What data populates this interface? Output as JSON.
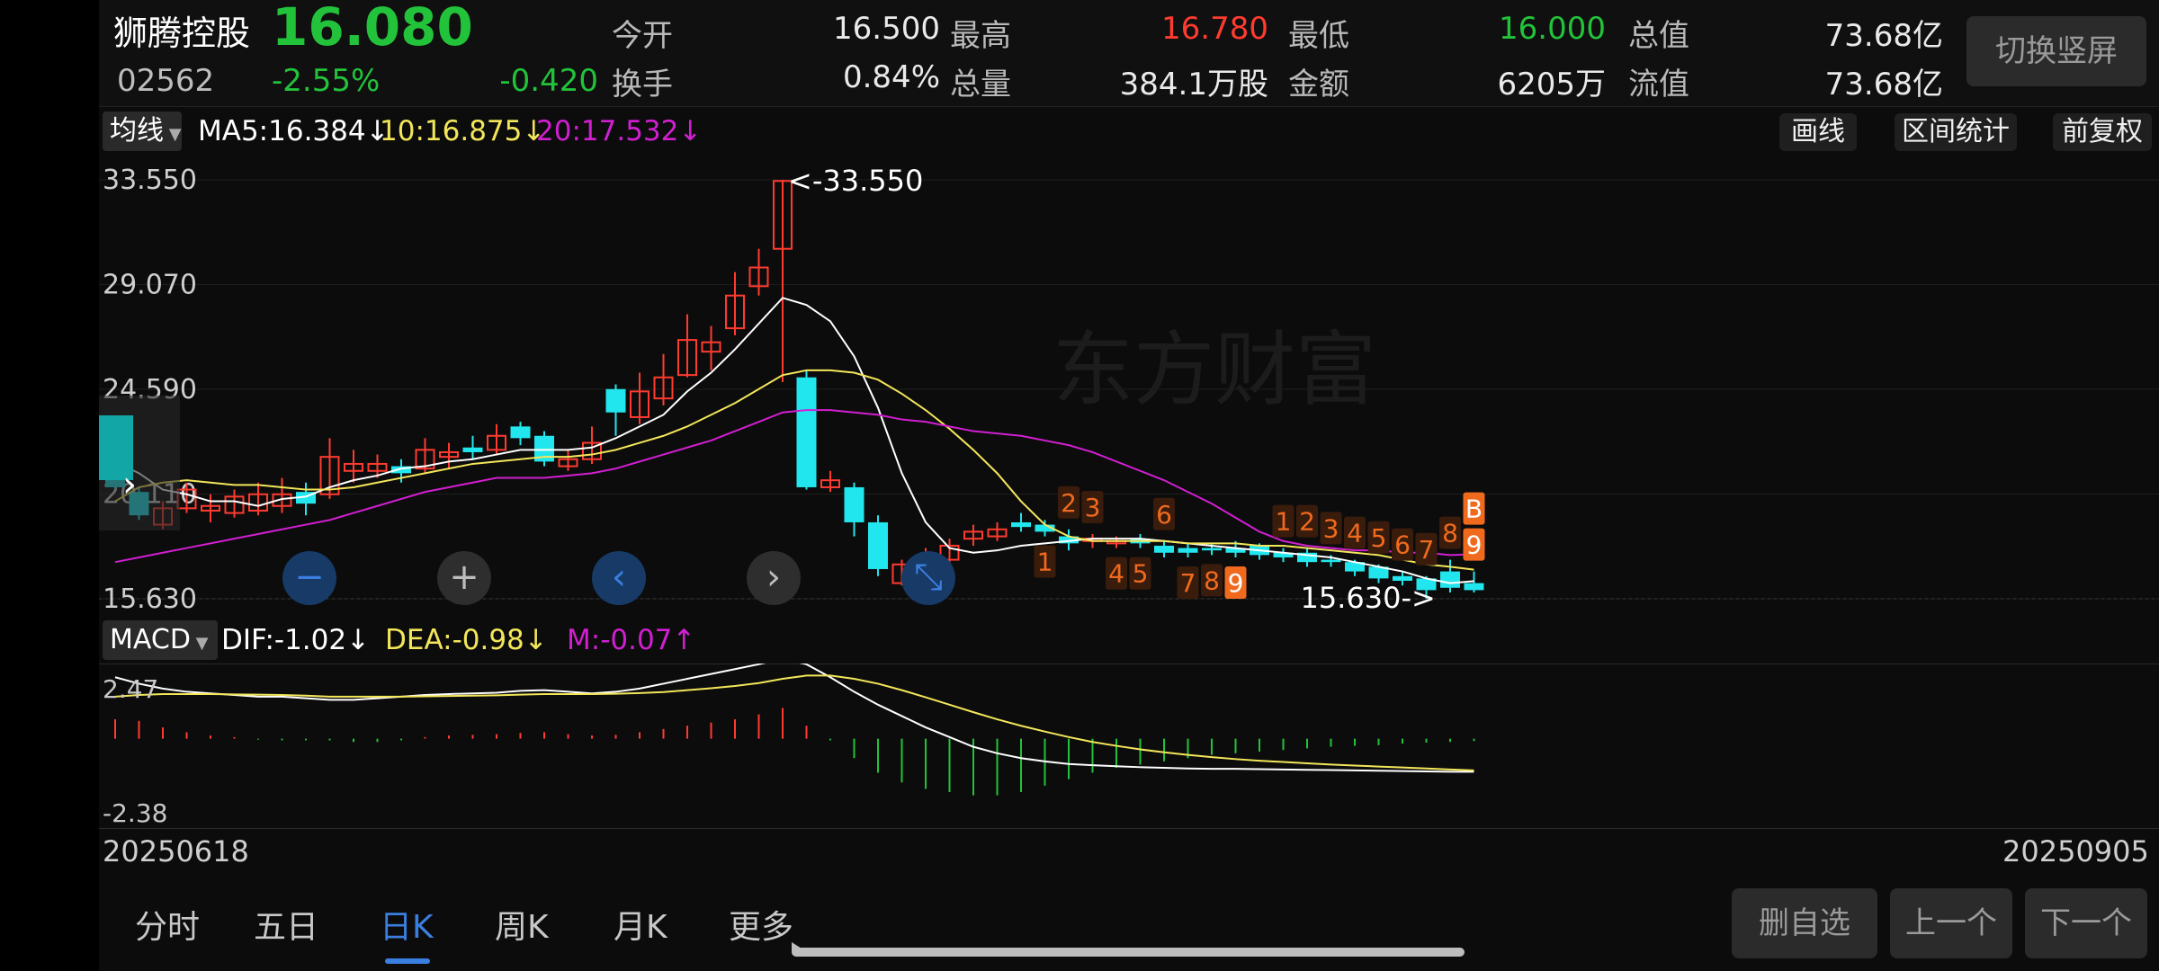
{
  "colors": {
    "up": "#ff3b30",
    "down": "#22c33a",
    "cyan": "#22e6ee",
    "ma5": "#ffffff",
    "ma10": "#f3e65a",
    "ma20": "#d11fd1",
    "bg": "#0c0c0c",
    "accent": "#3a7fe0",
    "tdcount": "#f06a1e"
  },
  "header": {
    "name": "狮腾控股",
    "price": "16.080",
    "code": "02562",
    "change_pct": "-2.55%",
    "change_abs": "-0.420",
    "open_label": "今开",
    "open": "16.500",
    "high_label": "最高",
    "high": "16.780",
    "low_label": "最低",
    "low": "16.000",
    "mktcap_label": "总值",
    "mktcap": "73.68亿",
    "turnover_label": "换手",
    "turnover": "0.84%",
    "volume_label": "总量",
    "volume": "384.1万股",
    "amount_label": "金额",
    "amount": "6205万",
    "float_label": "流值",
    "float_cap": "73.68亿",
    "switch_button": "切换竖屏"
  },
  "ma_bar": {
    "selector": "均线",
    "ma5": "MA5:16.384",
    "ma10": "10:16.875",
    "ma20": "20:17.532",
    "arrow": "↓",
    "draw_button": "画线",
    "range_stats_button": "区间统计",
    "adjust_button": "前复权"
  },
  "kline": {
    "y_labels": [
      "33.550",
      "29.070",
      "24.590",
      "20.110",
      "15.630"
    ],
    "max_marker": "<-33.550",
    "min_marker": "15.630->",
    "watermark": "东方财富",
    "ymin": 15.63,
    "ymax": 33.55,
    "nav_icons": [
      "zoom-out-icon",
      "zoom-in-icon",
      "chevron-left-icon",
      "chevron-right-icon",
      "collapse-icon"
    ]
  },
  "macd_bar": {
    "selector": "MACD",
    "dif": "DIF:-1.02",
    "dea": "DEA:-0.98",
    "m": "M:-0.07",
    "down": "↓",
    "up": "↑"
  },
  "macd": {
    "y_top": "2.47",
    "y_bottom": "-2.38"
  },
  "dates": {
    "start": "20250618",
    "end": "20250905"
  },
  "tabs": [
    "分时",
    "五日",
    "日K",
    "周K",
    "月K",
    "更多"
  ],
  "active_tab": 2,
  "actions": {
    "remove": "删自选",
    "prev": "上一个",
    "next": "下一个"
  },
  "td_counts": [
    {
      "n": "2",
      "i": 40,
      "above": true
    },
    {
      "n": "3",
      "i": 41,
      "above": true
    },
    {
      "n": "6",
      "i": 44,
      "above": true
    },
    {
      "n": "1",
      "i": 39,
      "above": false
    },
    {
      "n": "4",
      "i": 42,
      "above": false
    },
    {
      "n": "5",
      "i": 43,
      "above": false
    },
    {
      "n": "7",
      "i": 45,
      "above": false
    },
    {
      "n": "8",
      "i": 46,
      "above": false
    },
    {
      "n": "9",
      "i": 47,
      "above": false,
      "hl": true
    },
    {
      "n": "1",
      "i": 49,
      "above": true
    },
    {
      "n": "2",
      "i": 50,
      "above": true
    },
    {
      "n": "3",
      "i": 51,
      "above": true
    },
    {
      "n": "4",
      "i": 52,
      "above": true
    },
    {
      "n": "5",
      "i": 53,
      "above": true
    },
    {
      "n": "6",
      "i": 54,
      "above": true
    },
    {
      "n": "7",
      "i": 55,
      "above": true
    },
    {
      "n": "8",
      "i": 56,
      "above": true
    },
    {
      "n": "9",
      "i": 57,
      "above": true,
      "hl": true
    },
    {
      "n": "B",
      "i": 57,
      "above": true,
      "hl": true,
      "b": true
    }
  ],
  "chart_data": {
    "type": "candlestick",
    "title": "",
    "date_range": [
      "20250618",
      "20250905"
    ],
    "ylim": [
      15.63,
      33.55
    ],
    "candles": [
      [
        22.6,
        20.4,
        22.6,
        20.3
      ],
      [
        20.2,
        19.2,
        20.4,
        19.0
      ],
      [
        18.8,
        19.5,
        19.8,
        18.6
      ],
      [
        19.5,
        20.3,
        20.6,
        19.3
      ],
      [
        19.4,
        19.6,
        20.1,
        18.9
      ],
      [
        19.3,
        20.0,
        20.3,
        19.1
      ],
      [
        19.4,
        20.1,
        20.6,
        19.2
      ],
      [
        19.6,
        20.1,
        20.8,
        19.3
      ],
      [
        20.2,
        19.7,
        20.6,
        19.2
      ],
      [
        20.1,
        21.7,
        22.5,
        19.9
      ],
      [
        21.1,
        21.4,
        22.0,
        20.6
      ],
      [
        21.1,
        21.4,
        21.8,
        20.8
      ],
      [
        21.3,
        21.0,
        21.6,
        20.6
      ],
      [
        21.2,
        22.0,
        22.5,
        21.0
      ],
      [
        21.7,
        21.9,
        22.3,
        21.2
      ],
      [
        22.1,
        21.9,
        22.6,
        21.6
      ],
      [
        22.0,
        22.6,
        23.1,
        21.8
      ],
      [
        23.0,
        22.5,
        23.2,
        22.2
      ],
      [
        22.6,
        21.5,
        22.8,
        21.3
      ],
      [
        21.3,
        21.6,
        22.0,
        21.1
      ],
      [
        21.6,
        22.3,
        23.0,
        21.4
      ],
      [
        24.6,
        23.6,
        24.8,
        22.6
      ],
      [
        23.4,
        24.5,
        25.3,
        23.1
      ],
      [
        24.2,
        25.1,
        26.1,
        23.9
      ],
      [
        25.2,
        26.7,
        27.8,
        25.1
      ],
      [
        26.2,
        26.6,
        27.3,
        25.4
      ],
      [
        27.2,
        28.6,
        29.6,
        26.9
      ],
      [
        29.0,
        29.8,
        30.6,
        28.6
      ],
      [
        30.6,
        33.5,
        33.55,
        24.9
      ],
      [
        25.1,
        20.4,
        25.4,
        20.3
      ],
      [
        20.4,
        20.7,
        21.1,
        20.2
      ],
      [
        20.4,
        18.9,
        20.6,
        18.3
      ],
      [
        18.9,
        16.9,
        19.2,
        16.6
      ],
      [
        16.3,
        17.1,
        17.3,
        16.2
      ],
      [
        17.2,
        17.5,
        17.8,
        16.9
      ],
      [
        17.3,
        17.9,
        18.2,
        16.9
      ],
      [
        18.2,
        18.5,
        18.8,
        17.9
      ],
      [
        18.3,
        18.6,
        18.9,
        18.1
      ],
      [
        18.9,
        18.7,
        19.3,
        18.5
      ],
      [
        18.8,
        18.5,
        19.0,
        18.3
      ],
      [
        18.3,
        18.0,
        18.6,
        17.7
      ],
      [
        18.1,
        18.2,
        18.4,
        17.8
      ],
      [
        18.0,
        18.1,
        18.3,
        17.8
      ],
      [
        18.2,
        18.0,
        18.4,
        17.8
      ],
      [
        17.9,
        17.6,
        18.1,
        17.4
      ],
      [
        17.8,
        17.6,
        18.0,
        17.4
      ],
      [
        17.8,
        17.7,
        18.0,
        17.5
      ],
      [
        17.8,
        17.6,
        18.1,
        17.4
      ],
      [
        17.9,
        17.5,
        18.0,
        17.3
      ],
      [
        17.6,
        17.4,
        17.8,
        17.2
      ],
      [
        17.6,
        17.2,
        17.8,
        17.0
      ],
      [
        17.3,
        17.2,
        17.5,
        17.0
      ],
      [
        17.2,
        16.8,
        17.3,
        16.6
      ],
      [
        17.0,
        16.5,
        17.1,
        16.3
      ],
      [
        16.6,
        16.4,
        16.8,
        16.2
      ],
      [
        16.5,
        16.0,
        16.6,
        15.63
      ],
      [
        16.8,
        16.1,
        17.3,
        15.9
      ],
      [
        16.3,
        16.0,
        16.8,
        15.9
      ]
    ],
    "ma5": [
      21.5,
      21.0,
      20.3,
      20.1,
      19.8,
      19.8,
      19.6,
      19.9,
      20.0,
      20.4,
      20.7,
      20.9,
      21.2,
      21.3,
      21.5,
      21.6,
      21.8,
      22.0,
      22.0,
      22.0,
      22.1,
      22.5,
      23.0,
      23.5,
      24.5,
      25.3,
      26.3,
      27.4,
      28.5,
      28.2,
      27.5,
      26.0,
      23.8,
      21.0,
      18.9,
      17.8,
      17.6,
      17.7,
      17.9,
      18.0,
      18.1,
      18.2,
      18.2,
      18.2,
      18.1,
      18.0,
      17.9,
      17.8,
      17.7,
      17.6,
      17.5,
      17.4,
      17.2,
      17.0,
      16.8,
      16.5,
      16.3,
      16.384
    ],
    "ma10": [
      19.8,
      20.4,
      20.6,
      20.7,
      20.6,
      20.5,
      20.5,
      20.4,
      20.3,
      20.3,
      20.4,
      20.6,
      20.8,
      21.0,
      21.2,
      21.4,
      21.5,
      21.6,
      21.7,
      21.7,
      21.8,
      22.0,
      22.3,
      22.6,
      23.0,
      23.5,
      24.0,
      24.6,
      25.2,
      25.4,
      25.4,
      25.3,
      25.0,
      24.4,
      23.7,
      22.9,
      22.0,
      21.0,
      19.8,
      18.8,
      18.3,
      18.1,
      18.1,
      18.1,
      18.1,
      18.0,
      18.0,
      18.0,
      17.9,
      17.9,
      17.8,
      17.7,
      17.6,
      17.5,
      17.3,
      17.1,
      17.0,
      16.875
    ],
    "ma20": [
      17.2,
      17.4,
      17.6,
      17.8,
      18.0,
      18.2,
      18.4,
      18.6,
      18.8,
      19.0,
      19.3,
      19.6,
      19.9,
      20.2,
      20.4,
      20.6,
      20.8,
      20.8,
      20.8,
      20.9,
      21.0,
      21.2,
      21.5,
      21.8,
      22.1,
      22.4,
      22.8,
      23.2,
      23.6,
      23.7,
      23.7,
      23.6,
      23.5,
      23.3,
      23.2,
      23.0,
      22.8,
      22.7,
      22.6,
      22.4,
      22.2,
      21.9,
      21.5,
      21.1,
      20.7,
      20.2,
      19.7,
      19.1,
      18.5,
      18.1,
      17.9,
      17.8,
      17.7,
      17.7,
      17.6,
      17.6,
      17.5,
      17.532
    ],
    "macd_dif": [
      1.9,
      1.7,
      1.55,
      1.45,
      1.4,
      1.35,
      1.3,
      1.3,
      1.25,
      1.2,
      1.2,
      1.25,
      1.3,
      1.35,
      1.38,
      1.4,
      1.42,
      1.48,
      1.5,
      1.45,
      1.4,
      1.45,
      1.55,
      1.7,
      1.85,
      2.0,
      2.15,
      2.3,
      2.47,
      2.3,
      1.9,
      1.45,
      1.05,
      0.7,
      0.35,
      0.05,
      -0.25,
      -0.45,
      -0.6,
      -0.7,
      -0.78,
      -0.82,
      -0.85,
      -0.88,
      -0.9,
      -0.92,
      -0.93,
      -0.93,
      -0.94,
      -0.95,
      -0.96,
      -0.97,
      -0.98,
      -0.99,
      -1.0,
      -1.01,
      -1.02,
      -1.02
    ],
    "macd_dea": [
      1.3,
      1.35,
      1.38,
      1.38,
      1.38,
      1.37,
      1.36,
      1.35,
      1.33,
      1.3,
      1.3,
      1.3,
      1.3,
      1.31,
      1.32,
      1.33,
      1.34,
      1.36,
      1.38,
      1.38,
      1.38,
      1.39,
      1.41,
      1.44,
      1.5,
      1.56,
      1.63,
      1.72,
      1.85,
      1.95,
      1.95,
      1.85,
      1.7,
      1.5,
      1.28,
      1.05,
      0.82,
      0.6,
      0.4,
      0.22,
      0.05,
      -0.1,
      -0.22,
      -0.33,
      -0.42,
      -0.5,
      -0.57,
      -0.63,
      -0.68,
      -0.72,
      -0.76,
      -0.8,
      -0.83,
      -0.86,
      -0.89,
      -0.92,
      -0.95,
      -0.98
    ],
    "macd_hist": [
      0.6,
      0.55,
      0.35,
      0.2,
      0.1,
      0.05,
      -0.02,
      -0.05,
      -0.05,
      -0.05,
      -0.1,
      -0.1,
      -0.05,
      0.05,
      0.1,
      0.12,
      0.14,
      0.18,
      0.2,
      0.14,
      0.1,
      0.12,
      0.2,
      0.3,
      0.4,
      0.5,
      0.6,
      0.75,
      0.95,
      0.4,
      -0.05,
      -0.6,
      -1.05,
      -1.35,
      -1.55,
      -1.65,
      -1.75,
      -1.75,
      -1.65,
      -1.45,
      -1.25,
      -1.05,
      -0.9,
      -0.8,
      -0.7,
      -0.6,
      -0.5,
      -0.45,
      -0.4,
      -0.35,
      -0.3,
      -0.25,
      -0.22,
      -0.2,
      -0.15,
      -0.12,
      -0.1,
      -0.07
    ]
  }
}
